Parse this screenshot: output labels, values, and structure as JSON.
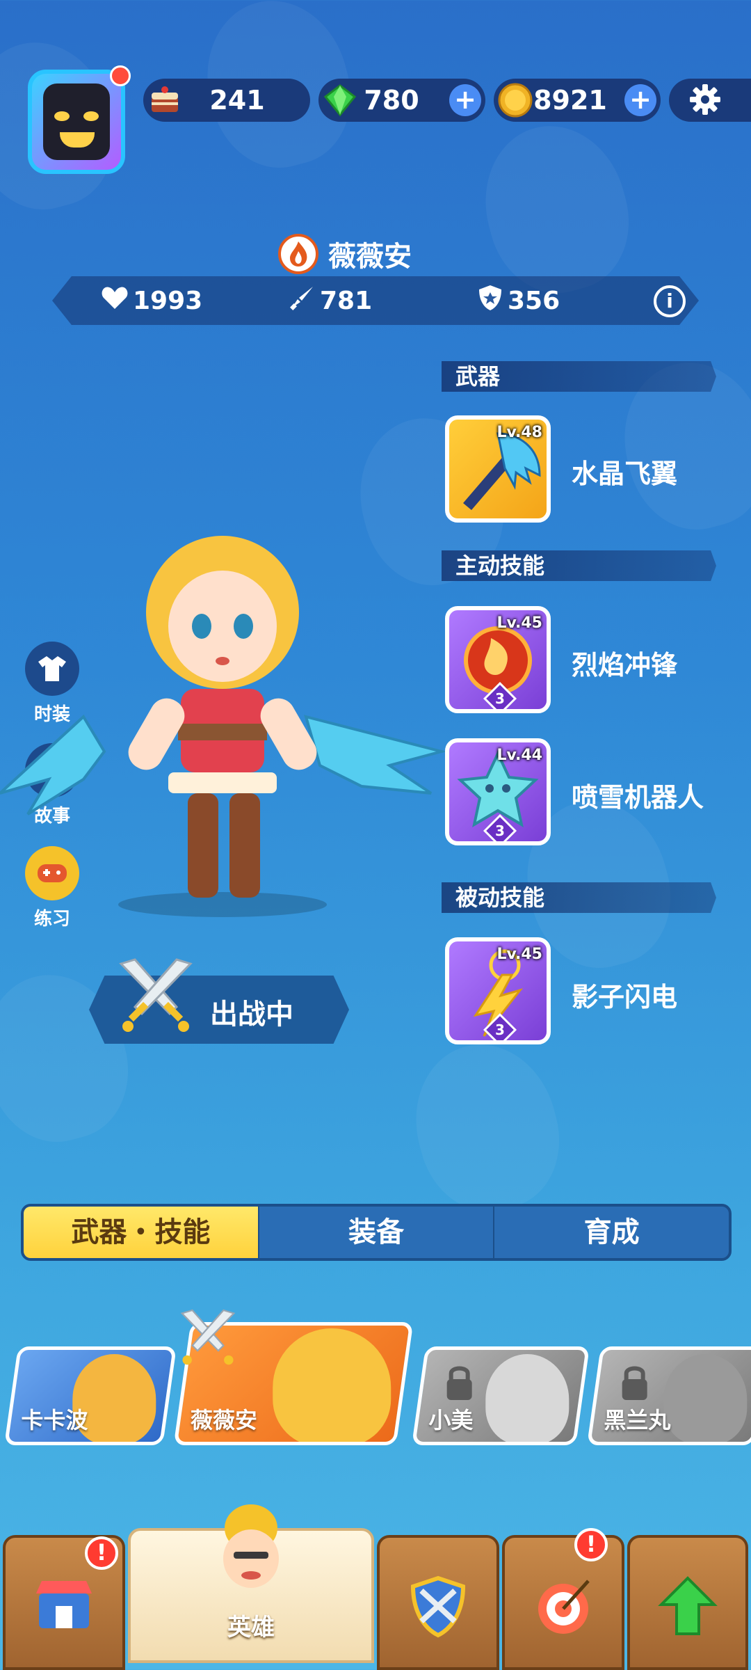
{
  "resources": {
    "cake": {
      "value": "241",
      "icon": "cake-icon"
    },
    "gems": {
      "value": "780",
      "icon": "gem-icon",
      "plus": "+"
    },
    "coins": {
      "value": "8921",
      "icon": "coin-icon",
      "plus": "+"
    },
    "settings_icon": "gear-icon"
  },
  "hero": {
    "name": "薇薇安",
    "element_icon": "fire-icon",
    "stats": {
      "hp": "1993",
      "attack": "781",
      "defense": "356"
    },
    "info_label": "i"
  },
  "loadout": {
    "weapon_header": "武器",
    "weapon": {
      "level": "Lv.48",
      "name": "水晶飞翼"
    },
    "active_header": "主动技能",
    "active_skills": [
      {
        "level": "Lv.45",
        "name": "烈焰冲锋",
        "rank": "3"
      },
      {
        "level": "Lv.44",
        "name": "喷雪机器人",
        "rank": "3"
      }
    ],
    "passive_header": "被动技能",
    "passive_skills": [
      {
        "level": "Lv.45",
        "name": "影子闪电",
        "rank": "3"
      }
    ]
  },
  "side_buttons": [
    {
      "label": "时装",
      "icon": "shirt-icon"
    },
    {
      "label": "故事",
      "icon": "book-icon"
    },
    {
      "label": "练习",
      "icon": "gamepad-icon"
    }
  ],
  "deploy": {
    "label": "出战中",
    "icon": "crossed-swords-icon"
  },
  "tabs": [
    {
      "label": "武器・技能",
      "active": true
    },
    {
      "label": "装备",
      "active": false
    },
    {
      "label": "育成",
      "active": false
    }
  ],
  "heroes": [
    {
      "name": "卡卡波",
      "locked": false,
      "selected": false
    },
    {
      "name": "薇薇安",
      "locked": false,
      "selected": true
    },
    {
      "name": "小美",
      "locked": true,
      "selected": false
    },
    {
      "name": "黑兰丸",
      "locked": true,
      "selected": false
    }
  ],
  "bottom_nav": [
    {
      "label": "",
      "icon": "shop-icon",
      "alert": "!"
    },
    {
      "label": "英雄",
      "icon": "hero-portrait-icon",
      "active": true
    },
    {
      "label": "",
      "icon": "battle-shield-icon"
    },
    {
      "label": "",
      "icon": "target-icon",
      "alert": "!"
    },
    {
      "label": "",
      "icon": "upgrade-arrow-icon"
    }
  ]
}
